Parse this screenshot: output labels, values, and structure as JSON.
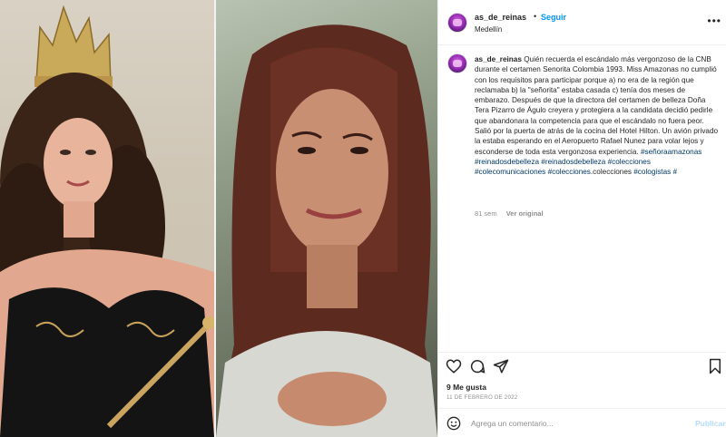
{
  "post": {
    "username": "as_de_reinas",
    "dot": "•",
    "follow_label": "Seguir",
    "location": "Medellín",
    "more_icon": "more-horizontal-icon"
  },
  "caption": {
    "username": "as_de_reinas",
    "text": "Quién recuerda el escándalo más vergonzoso de la CNB durante el certamen Senorita Colombia 1993. Miss Amazonas no cumplió con los requisitos para participar porque a) no era de la región que reclamaba b) la \"señorita\" estaba casada c) tenía dos meses de embarazo. Después de que la directora del certamen de belleza Doña Tera Pizarro de Águlo creyera y protegiera a la candidata decidió pedirle que abandonara la competencia para que el escándalo no fuera peor. Salió por la puerta de atrás de la cocina del Hotel Hilton. Un avión privado la estaba esperando en el Aeropuerto Rafael Nunez para volar lejos y esconderse de toda esta vergonzosa experiencia. ",
    "hashtags_line1": [
      "#señoraamazonas",
      "#reinadosdebelleza"
    ],
    "hashtags_line2": [
      "#reinadosdebelleza",
      "#colecciones",
      "#colecomunicaciones"
    ],
    "hashtag_line3_a": "#colecciones",
    "plain_word": ".colecciones ",
    "hashtag_line3_b": "#cologistas",
    "hashtag_line3_c": "#",
    "age": "81 sem",
    "see_original": "Ver original"
  },
  "engagement": {
    "likes": "9 Me gusta",
    "date": "11 DE FEBRERO DE 2022"
  },
  "comment_box": {
    "placeholder": "Agrega un comentario...",
    "publish_label": "Publicar"
  },
  "icons": {
    "like": "heart-icon",
    "comment": "comment-icon",
    "share": "share-icon",
    "save": "bookmark-icon",
    "emoji": "emoji-icon"
  },
  "colors": {
    "link_blue": "#0095f6",
    "hashtag": "#00376b",
    "muted": "#8e8e8e",
    "publish_disabled": "#b3dbff"
  }
}
